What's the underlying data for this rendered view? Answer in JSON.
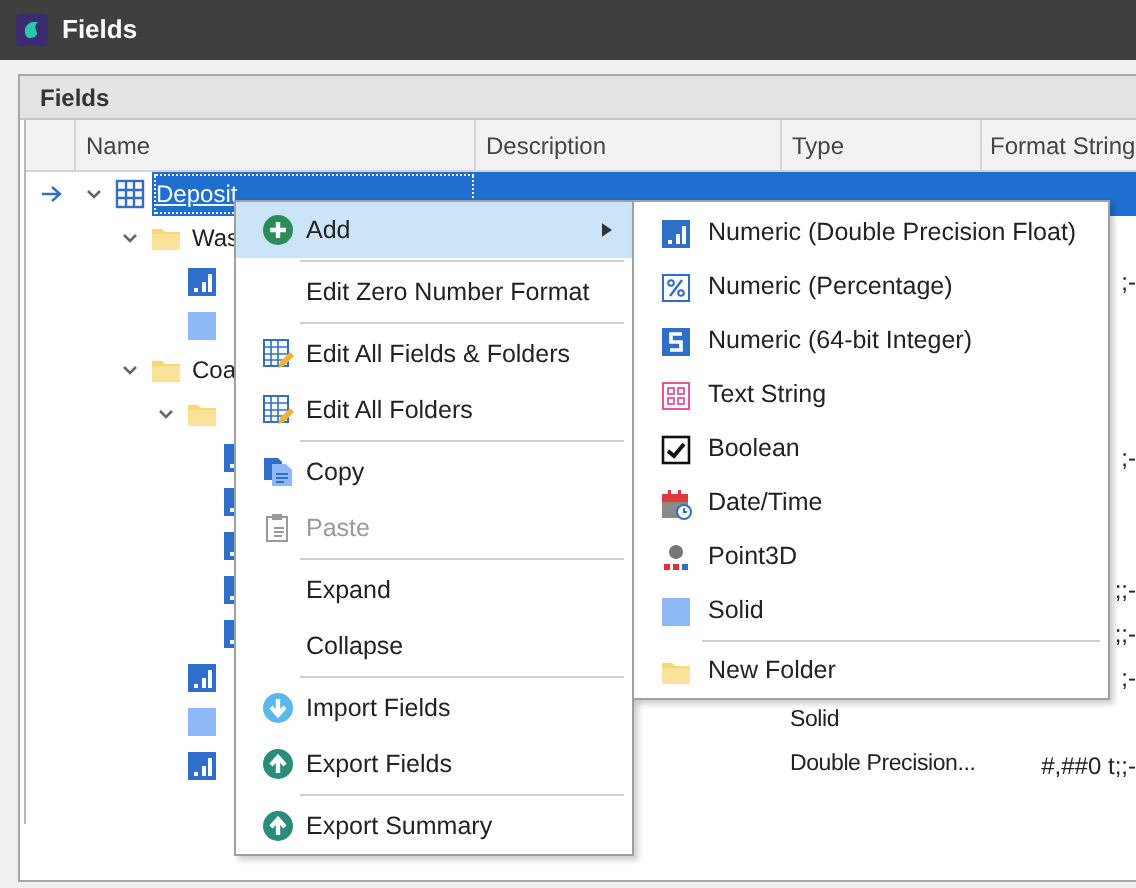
{
  "window": {
    "title": "Fields"
  },
  "panel": {
    "title": "Fields"
  },
  "grid": {
    "columns": [
      "Name",
      "Description",
      "Type",
      "Format String"
    ],
    "rows": [
      {
        "kind": "grid",
        "name": "Deposit",
        "selected": true,
        "current": true,
        "expanded": true,
        "children": [
          {
            "kind": "folder",
            "name": "Was",
            "selected": false,
            "current": false,
            "expanded": true,
            "children": [
              {
                "kind": "numeric",
                "selected": false,
                "current": false,
                "format": ";-"
              },
              {
                "kind": "solid",
                "selected": false,
                "current": false
              }
            ]
          },
          {
            "kind": "folder",
            "name": "Coa",
            "selected": false,
            "current": false,
            "expanded": true,
            "children": [
              {
                "kind": "folder",
                "selected": false,
                "current": false,
                "expanded": true,
                "children": [
                  {
                    "kind": "numeric",
                    "selected": false,
                    "current": false,
                    "format": ";-"
                  },
                  {
                    "kind": "numeric",
                    "selected": false,
                    "current": false
                  },
                  {
                    "kind": "numeric",
                    "selected": false,
                    "current": false
                  },
                  {
                    "kind": "numeric",
                    "selected": false,
                    "current": false,
                    "format": ";;-"
                  },
                  {
                    "kind": "numeric",
                    "selected": false,
                    "current": false,
                    "format": ";;-"
                  }
                ]
              },
              {
                "kind": "numeric",
                "selected": false,
                "current": false,
                "format": ";-"
              },
              {
                "kind": "solid",
                "selected": false,
                "current": false,
                "type": "Solid"
              },
              {
                "kind": "numeric",
                "selected": false,
                "current": false,
                "type": "Double Precision...",
                "format": "#,##0 t;;-"
              }
            ]
          }
        ]
      }
    ]
  },
  "context_menu": {
    "items": [
      {
        "kind": "add",
        "label": "Add",
        "highlighted": true,
        "disabled": false,
        "submenu": true
      },
      {
        "kind": "separator"
      },
      {
        "kind": "plain",
        "label": "Edit Zero Number Format",
        "highlighted": false,
        "disabled": false,
        "submenu": false
      },
      {
        "kind": "separator"
      },
      {
        "kind": "edit",
        "label": "Edit All Fields & Folders",
        "highlighted": false,
        "disabled": false,
        "submenu": false
      },
      {
        "kind": "edit",
        "label": "Edit All Folders",
        "highlighted": false,
        "disabled": false,
        "submenu": false
      },
      {
        "kind": "separator"
      },
      {
        "kind": "copy",
        "label": "Copy",
        "highlighted": false,
        "disabled": false,
        "submenu": false
      },
      {
        "kind": "paste",
        "label": "Paste",
        "highlighted": false,
        "disabled": true,
        "submenu": false
      },
      {
        "kind": "separator"
      },
      {
        "kind": "plain",
        "label": "Expand",
        "highlighted": false,
        "disabled": false,
        "submenu": false
      },
      {
        "kind": "plain",
        "label": "Collapse",
        "highlighted": false,
        "disabled": false,
        "submenu": false
      },
      {
        "kind": "separator"
      },
      {
        "kind": "import",
        "label": "Import Fields",
        "highlighted": false,
        "disabled": false,
        "submenu": false
      },
      {
        "kind": "export",
        "label": "Export Fields",
        "highlighted": false,
        "disabled": false,
        "submenu": false
      },
      {
        "kind": "separator"
      },
      {
        "kind": "export",
        "label": "Export Summary",
        "highlighted": false,
        "disabled": false,
        "submenu": false
      }
    ]
  },
  "submenu": {
    "items": [
      {
        "kind": "numeric",
        "label": "Numeric (Double Precision Float)"
      },
      {
        "kind": "percent",
        "label": "Numeric (Percentage)"
      },
      {
        "kind": "integer",
        "label": "Numeric (64-bit Integer)"
      },
      {
        "kind": "text",
        "label": "Text String"
      },
      {
        "kind": "boolean",
        "label": "Boolean"
      },
      {
        "kind": "datetime",
        "label": "Date/Time"
      },
      {
        "kind": "point3d",
        "label": "Point3D"
      },
      {
        "kind": "solid",
        "label": "Solid"
      },
      {
        "kind": "separator"
      },
      {
        "kind": "folder",
        "label": "New Folder"
      }
    ]
  }
}
